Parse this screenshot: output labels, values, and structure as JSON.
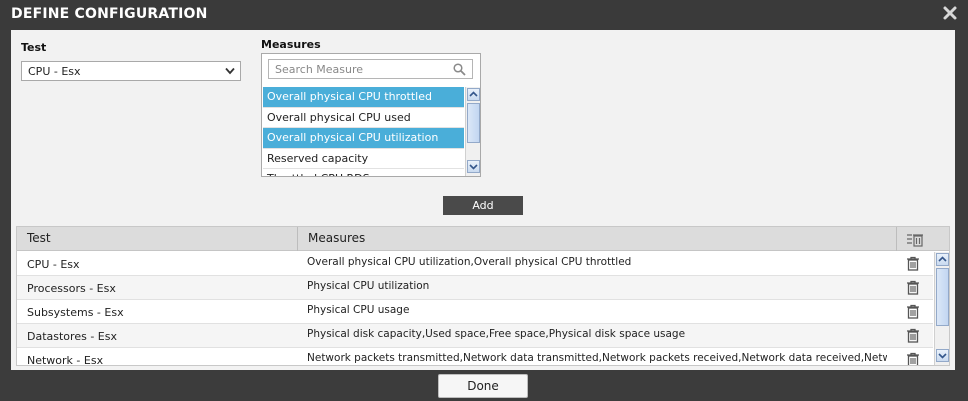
{
  "window": {
    "title": "DEFINE CONFIGURATION",
    "close_icon": "close-icon"
  },
  "form": {
    "test_label": "Test",
    "test_value": "CPU - Esx",
    "measures_label": "Measures",
    "search_placeholder": "Search Measure",
    "measures": [
      {
        "label": "Overall physical CPU throttled",
        "selected": true
      },
      {
        "label": "Overall physical CPU used",
        "selected": false
      },
      {
        "label": "Overall physical CPU utilization",
        "selected": true
      },
      {
        "label": "Reserved capacity",
        "selected": false
      },
      {
        "label": "Throttled CPU RDS",
        "selected": false
      }
    ],
    "add_label": "Add"
  },
  "table": {
    "columns": [
      "Test",
      "Measures"
    ],
    "header_icon": "delete-all-icon",
    "rows": [
      {
        "test": "CPU - Esx",
        "measures": "Overall physical CPU utilization,Overall physical CPU throttled"
      },
      {
        "test": "Processors - Esx",
        "measures": "Physical CPU utilization"
      },
      {
        "test": "Subsystems - Esx",
        "measures": "Physical CPU usage"
      },
      {
        "test": "Datastores - Esx",
        "measures": "Physical disk capacity,Used space,Free space,Physical disk space usage"
      },
      {
        "test": "Network - Esx",
        "measures": "Network packets transmitted,Network data transmitted,Network packets received,Network data received,Network"
      }
    ]
  },
  "footer": {
    "done_label": "Done"
  },
  "colors": {
    "titlebar": "#3a3a3a",
    "selection": "#4aaed9",
    "add_button": "#4a4a4a"
  }
}
